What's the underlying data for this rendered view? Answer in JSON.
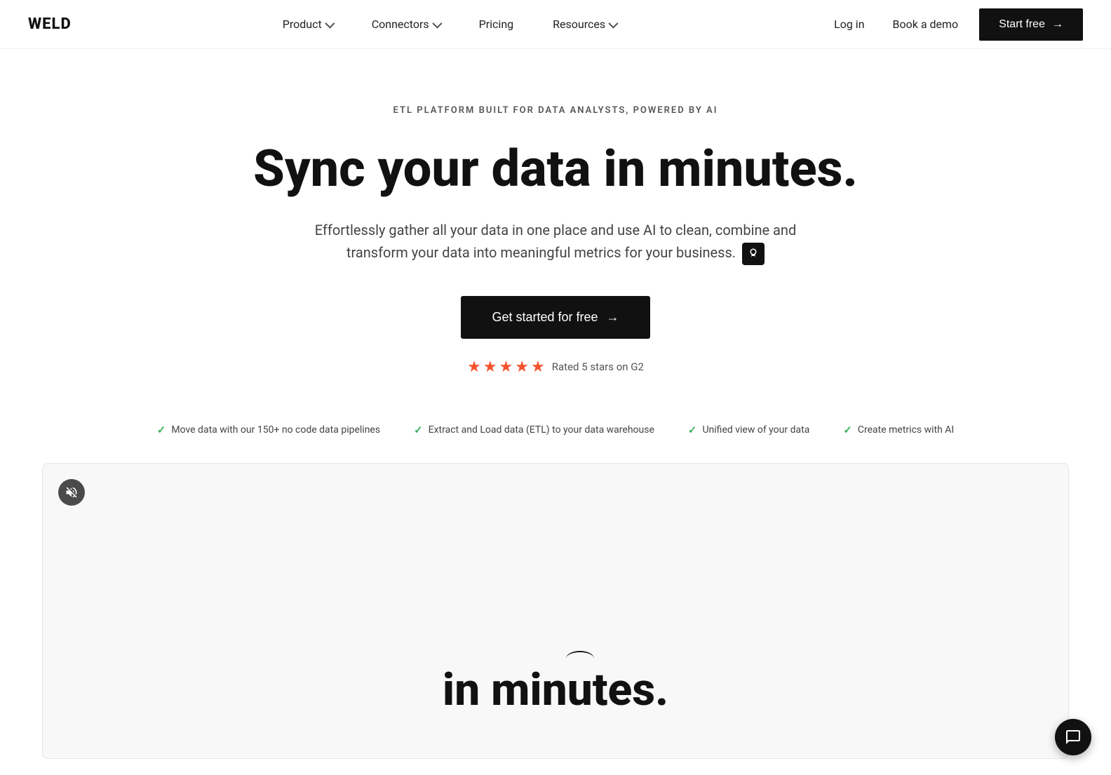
{
  "brand": {
    "logo": "WELD"
  },
  "nav": {
    "links": [
      {
        "id": "product",
        "label": "Product",
        "hasDropdown": true
      },
      {
        "id": "connectors",
        "label": "Connectors",
        "hasDropdown": true
      },
      {
        "id": "pricing",
        "label": "Pricing",
        "hasDropdown": false
      },
      {
        "id": "resources",
        "label": "Resources",
        "hasDropdown": true
      }
    ],
    "login_label": "Log in",
    "book_demo_label": "Book a demo",
    "start_free_label": "Start free"
  },
  "hero": {
    "eyebrow": "ETL PLATFORM BUILT FOR DATA ANALYSTS, POWERED BY AI",
    "title": "Sync your data in minutes.",
    "subtitle_1": "Effortlessly gather all your data in one place and use AI to clean, combine and",
    "subtitle_2": "transform your data into meaningful metrics for your business.",
    "cta_label": "Get started for free",
    "rating_text": "Rated 5 stars on G2",
    "stars_count": 5
  },
  "features": [
    {
      "id": "f1",
      "text": "Move data with our 150+ no code data pipelines"
    },
    {
      "id": "f2",
      "text": "Extract and Load data (ETL) to your data warehouse"
    },
    {
      "id": "f3",
      "text": "Unified view of your data"
    },
    {
      "id": "f4",
      "text": "Create metrics with AI"
    }
  ],
  "video_section": {
    "overlay_text_1": "in ",
    "overlay_text_2": "minutes."
  },
  "icons": {
    "mute": "volume-off",
    "chat": "chat-bubble",
    "arrow_right": "→",
    "check": "✓"
  },
  "colors": {
    "accent_black": "#111111",
    "star_orange": "#f4532e",
    "check_green": "#3bb05d"
  }
}
